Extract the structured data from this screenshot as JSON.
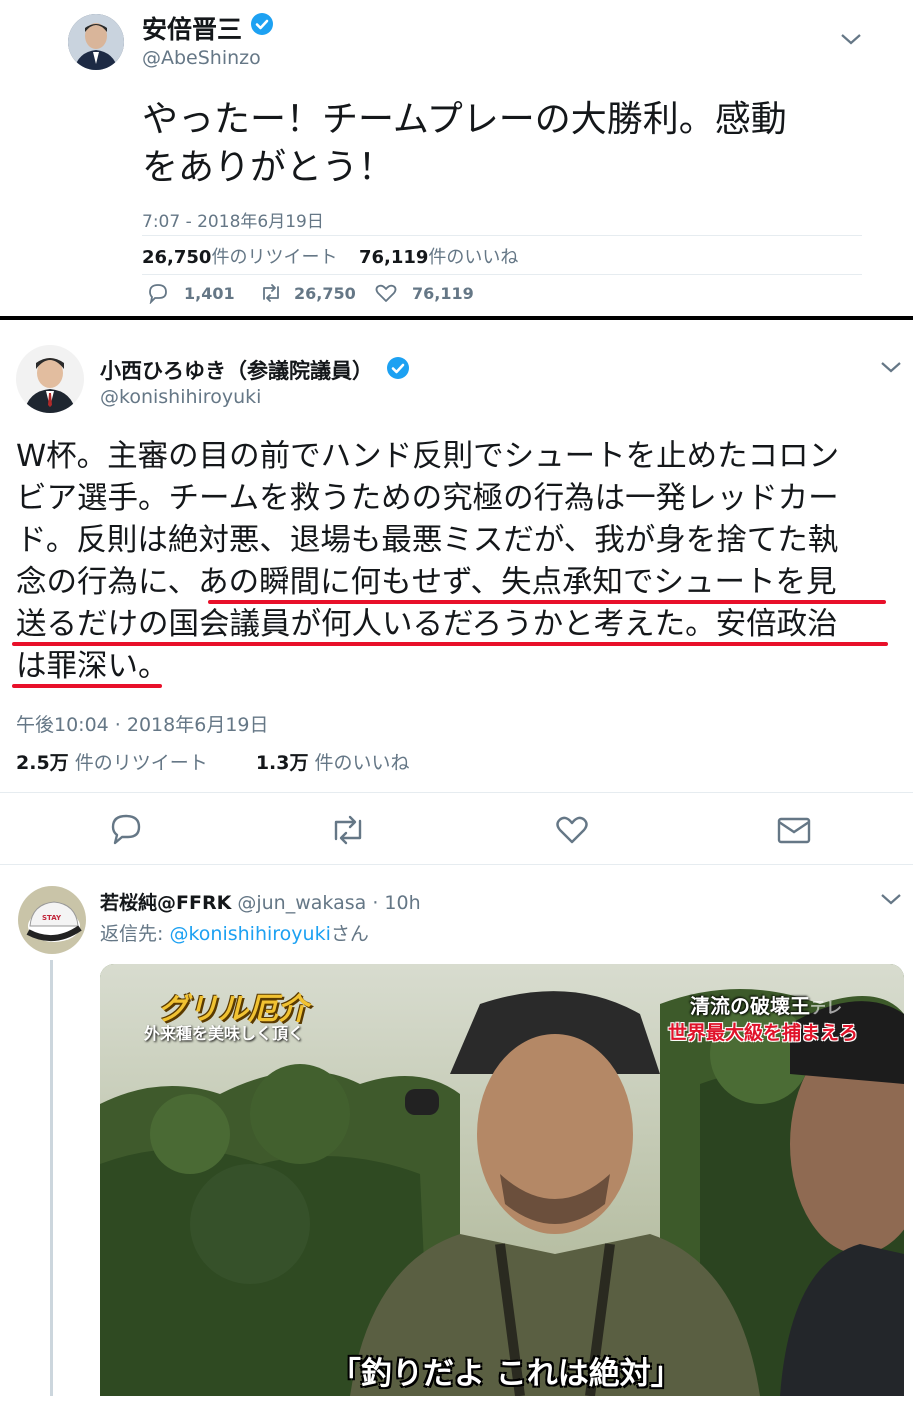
{
  "tweet1": {
    "name": "安倍晋三",
    "handle": "@AbeShinzo",
    "text_line1": "やったー！チームプレーの大勝利。感動",
    "text_line2": "をありがとう！",
    "timestamp": "7:07 - 2018年6月19日",
    "retweets_num": "26,750",
    "retweets_label": "件のリツイート",
    "likes_num": "76,119",
    "likes_label": "件のいいね",
    "reply_count": "1,401",
    "retweet_count": "26,750",
    "like_count": "76,119"
  },
  "tweet2": {
    "name": "小西ひろゆき（参議院議員）",
    "handle": "@konishihiroyuki",
    "lines": [
      "W杯。主審の目の前でハンド反則でシュートを止めたコロン",
      "ビア選手。チームを救うための究極の行為は一発レッドカー",
      "ド。反則は絶対悪、退場も最悪ミスだが、我が身を捨てた執",
      "念の行為に、あの瞬間に何もせず、失点承知でシュートを見",
      "送るだけの国会議員が何人いるだろうかと考えた。安倍政治",
      "は罪深い。"
    ],
    "timestamp": "午後10:04 · 2018年6月19日",
    "retweets_num": "2.5万",
    "retweets_label": "件のリツイート",
    "likes_num": "1.3万",
    "likes_label": "件のいいね"
  },
  "tweet3": {
    "name": "若桜純@FFRK",
    "handle": "@jun_wakasa",
    "time": "· 10h",
    "reply_prefix": "返信先: ",
    "reply_to": "@konishihiroyuki",
    "reply_suffix": "さん",
    "media": {
      "logo_title": "グリル厄介",
      "logo_subtitle": "外来種を美味しく頂く",
      "top_right_line1": "清流の破壊王",
      "top_right_channel": "テレ",
      "top_right_line2": "世界最大級を捕まえろ",
      "subtitle": "「釣りだよ これは絶対」"
    }
  },
  "colors": {
    "accent": "#1da1f2",
    "underline": "#e8102a",
    "muted": "#657786"
  }
}
